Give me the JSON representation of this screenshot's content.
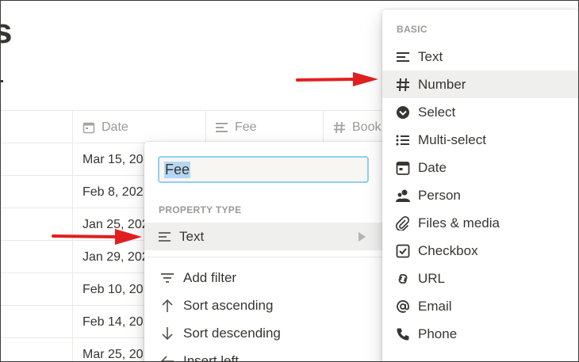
{
  "page": {
    "title_fragment": "s"
  },
  "table": {
    "columns": [
      {
        "label": "Date",
        "icon": "calendar-icon"
      },
      {
        "label": "Fee",
        "icon": "text-lines-icon"
      },
      {
        "label": "Book",
        "icon": "hash-icon"
      }
    ],
    "rows": [
      {
        "date": "Mar 15, 20"
      },
      {
        "date": "Feb 8, 202"
      },
      {
        "date": "Jan 25, 202"
      },
      {
        "date": "Jan 29, 202"
      },
      {
        "date": "Feb 10, 20"
      },
      {
        "date": "Feb 14, 20"
      },
      {
        "date": "Mar 25, 20"
      }
    ]
  },
  "property_menu": {
    "name_value": "Fee",
    "section_label": "PROPERTY TYPE",
    "current_type": "Text",
    "items": [
      {
        "label": "Add filter",
        "icon": "filter-icon"
      },
      {
        "label": "Sort ascending",
        "icon": "arrow-up-icon"
      },
      {
        "label": "Sort descending",
        "icon": "arrow-down-icon"
      },
      {
        "label": "Insert left",
        "icon": "arrow-left-icon"
      }
    ]
  },
  "type_menu": {
    "section_label": "BASIC",
    "highlighted": "Number",
    "items": [
      {
        "label": "Text",
        "icon": "text-lines-icon"
      },
      {
        "label": "Number",
        "icon": "hash-icon"
      },
      {
        "label": "Select",
        "icon": "select-circle-icon"
      },
      {
        "label": "Multi-select",
        "icon": "list-icon"
      },
      {
        "label": "Date",
        "icon": "calendar-icon"
      },
      {
        "label": "Person",
        "icon": "person-icon"
      },
      {
        "label": "Files & media",
        "icon": "paperclip-icon"
      },
      {
        "label": "Checkbox",
        "icon": "checkbox-icon"
      },
      {
        "label": "URL",
        "icon": "link-icon"
      },
      {
        "label": "Email",
        "icon": "at-icon"
      },
      {
        "label": "Phone",
        "icon": "phone-icon"
      }
    ]
  },
  "colors": {
    "annotation_arrow": "#e02020",
    "input_focus": "#8ed1ee",
    "hover_bg": "#efefee",
    "muted_text": "#9b9a97"
  }
}
